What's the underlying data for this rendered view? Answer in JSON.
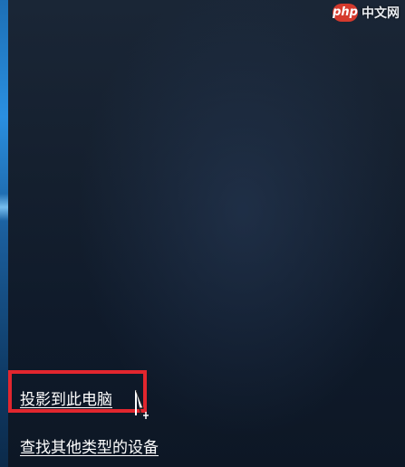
{
  "watermark": {
    "logo_text": "php",
    "site_text": "中文网"
  },
  "menu": {
    "project_to_pc": "投影到此电脑",
    "find_other_devices": "查找其他类型的设备"
  },
  "colors": {
    "highlight": "#e2262e",
    "background": "#0f1a2a",
    "text": "#ffffff"
  },
  "icons": {
    "cursor": "text-cursor-icon"
  }
}
